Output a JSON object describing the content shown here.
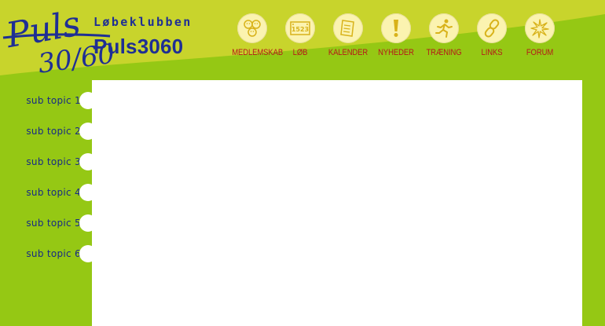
{
  "header": {
    "logo_text_top": "Puls",
    "logo_text_bottom": "30/60",
    "club_subtitle": "Løbeklubben",
    "club_name": "Puls3060"
  },
  "nav": [
    {
      "label": "MEDLEMSKAB",
      "icon": "smileys-icon"
    },
    {
      "label": "LØB",
      "icon": "race-number-icon",
      "icon_text": "1523"
    },
    {
      "label": "KALENDER",
      "icon": "calendar-icon"
    },
    {
      "label": "NYHEDER",
      "icon": "exclamation-icon"
    },
    {
      "label": "TRÆNING",
      "icon": "runner-icon"
    },
    {
      "label": "LINKS",
      "icon": "chain-link-icon"
    },
    {
      "label": "FORUM",
      "icon": "burst-icon"
    }
  ],
  "sidebar": {
    "items": [
      {
        "label": "sub topic 1"
      },
      {
        "label": "sub topic 2"
      },
      {
        "label": "sub topic 3"
      },
      {
        "label": "sub topic 4"
      },
      {
        "label": "sub topic 5"
      },
      {
        "label": "sub topic 6"
      }
    ]
  },
  "colors": {
    "background_green": "#95c814",
    "header_yellow_green": "#c8d42c",
    "brand_blue": "#1f2f94",
    "nav_red": "#b51919",
    "icon_circle": "#fbf3b0"
  }
}
